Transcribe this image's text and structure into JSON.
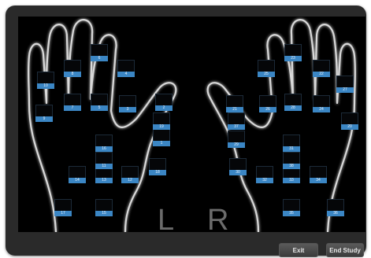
{
  "left_hand_letter": "L",
  "right_hand_letter": "R",
  "buttons": {
    "exit": "Exit",
    "end_study": "End Study"
  },
  "left_tiles": [
    {
      "id": "l-1",
      "label": "10"
    },
    {
      "id": "l-2",
      "label": "9"
    },
    {
      "id": "l-3",
      "label": "8"
    },
    {
      "id": "l-4",
      "label": "6"
    },
    {
      "id": "l-5",
      "label": "4"
    },
    {
      "id": "l-6",
      "label": "7"
    },
    {
      "id": "l-7",
      "label": "5"
    },
    {
      "id": "l-8",
      "label": "3"
    },
    {
      "id": "l-9",
      "label": "2"
    },
    {
      "id": "l-10",
      "label": "1"
    },
    {
      "id": "l-11",
      "label": "16"
    },
    {
      "id": "l-12",
      "label": "18"
    },
    {
      "id": "l-13",
      "label": "14"
    },
    {
      "id": "l-14",
      "label": "13"
    },
    {
      "id": "l-15",
      "label": "12"
    },
    {
      "id": "l-16",
      "label": "17"
    },
    {
      "id": "l-17",
      "label": "15"
    },
    {
      "id": "l-18",
      "label": "11"
    },
    {
      "id": "l-19",
      "label": "19"
    }
  ],
  "right_tiles": [
    {
      "id": "r-1",
      "label": "25"
    },
    {
      "id": "r-2",
      "label": "23"
    },
    {
      "id": "r-3",
      "label": "22"
    },
    {
      "id": "r-4",
      "label": "27"
    },
    {
      "id": "r-5",
      "label": "24"
    },
    {
      "id": "r-6",
      "label": "26"
    },
    {
      "id": "r-7",
      "label": "21"
    },
    {
      "id": "r-8",
      "label": "28"
    },
    {
      "id": "r-9",
      "label": "29"
    },
    {
      "id": "r-10",
      "label": "20"
    },
    {
      "id": "r-11",
      "label": "30"
    },
    {
      "id": "r-12",
      "label": "31"
    },
    {
      "id": "r-13",
      "label": "32"
    },
    {
      "id": "r-14",
      "label": "33"
    },
    {
      "id": "r-15",
      "label": "34"
    },
    {
      "id": "r-16",
      "label": "35"
    },
    {
      "id": "r-17",
      "label": "36"
    },
    {
      "id": "r-18",
      "label": "37"
    },
    {
      "id": "r-19",
      "label": "38"
    }
  ]
}
